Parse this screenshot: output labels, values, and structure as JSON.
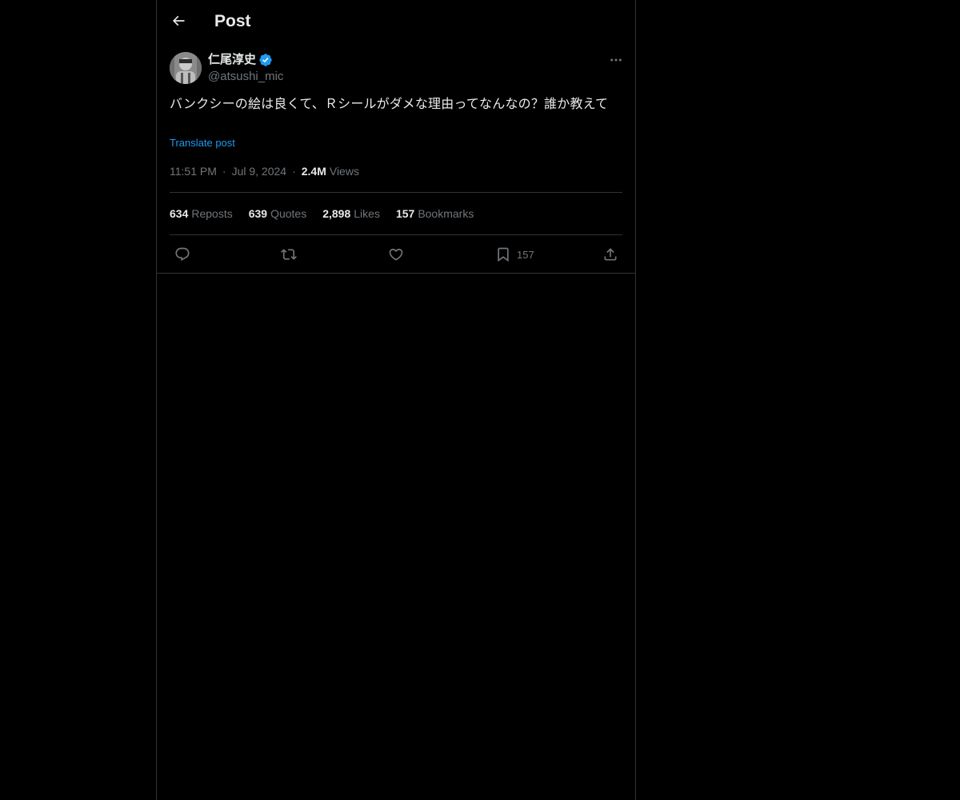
{
  "header": {
    "title": "Post",
    "back_icon": "arrow-left-icon"
  },
  "post": {
    "author": {
      "name": "仁尾淳史",
      "handle": "@atsushi_mic",
      "verified": true,
      "verified_color": "#1d9bf0"
    },
    "text": "バンクシーの絵は良くて、Ｒシールがダメな理由ってなんなの？誰か教えて",
    "translate_label": "Translate post",
    "time": "11:51 PM",
    "date": "Jul 9, 2024",
    "views_count": "2.4M",
    "views_label": "Views",
    "stats": [
      {
        "count": "634",
        "label": "Reposts"
      },
      {
        "count": "639",
        "label": "Quotes"
      },
      {
        "count": "2,898",
        "label": "Likes"
      },
      {
        "count": "157",
        "label": "Bookmarks"
      }
    ],
    "actions": {
      "reply_icon": "reply-icon",
      "repost_icon": "repost-icon",
      "like_icon": "heart-icon",
      "bookmark_icon": "bookmark-icon",
      "bookmark_count": "157",
      "share_icon": "share-icon"
    }
  },
  "colors": {
    "background": "#000000",
    "text_primary": "#e7e9ea",
    "text_secondary": "#71767b",
    "accent": "#1d9bf0",
    "border": "#2f3336"
  }
}
